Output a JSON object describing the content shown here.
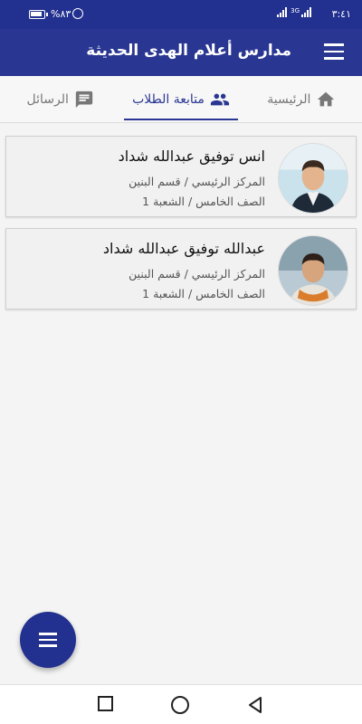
{
  "status_bar": {
    "time": "٣:٤١",
    "network_type": "3G",
    "battery_percent": "%٨٣"
  },
  "app_bar": {
    "title": "مدارس أعلام الهدى الحديثة"
  },
  "tabs": [
    {
      "label": "الرئيسية",
      "icon": "home-icon",
      "active": false
    },
    {
      "label": "متابعة الطلاب",
      "icon": "people-icon",
      "active": true
    },
    {
      "label": "الرسائل",
      "icon": "message-icon",
      "active": false
    }
  ],
  "students": [
    {
      "name": "انس توفيق عبدالله شداد",
      "center_line": "المركز الرئيسي  /  قسم البنين",
      "class_line": "الصف الخامس  /  الشعبة 1"
    },
    {
      "name": "عبدالله توفيق عبدالله شداد",
      "center_line": "المركز الرئيسي  /  قسم البنين",
      "class_line": "الصف الخامس  /  الشعبة 1"
    }
  ],
  "colors": {
    "primary": "#2a3792",
    "status_bar": "#22308f",
    "background": "#f4f4f4"
  }
}
